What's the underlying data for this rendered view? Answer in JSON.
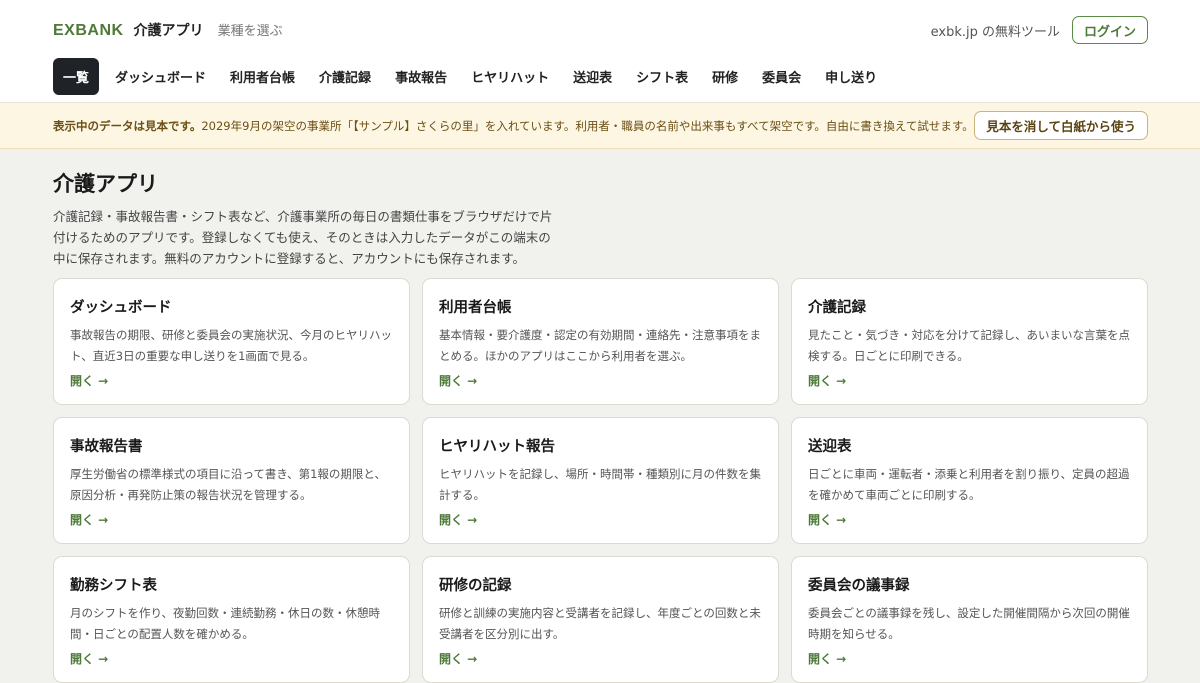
{
  "header": {
    "logo": "EXBANK",
    "app_name": "介護アプリ",
    "choose_business": "業種を選ぶ",
    "free_tools": "exbk.jp の無料ツール",
    "login": "ログイン"
  },
  "nav": {
    "items": [
      {
        "label": "一覧",
        "active": true
      },
      {
        "label": "ダッシュボード"
      },
      {
        "label": "利用者台帳"
      },
      {
        "label": "介護記録"
      },
      {
        "label": "事故報告"
      },
      {
        "label": "ヒヤリハット"
      },
      {
        "label": "送迎表"
      },
      {
        "label": "シフト表"
      },
      {
        "label": "研修"
      },
      {
        "label": "委員会"
      },
      {
        "label": "申し送り"
      }
    ]
  },
  "notice": {
    "bold": "表示中のデータは見本です。",
    "text": "2029年9月の架空の事業所「【サンプル】さくらの里」を入れています。利用者・職員の名前や出来事もすべて架空です。自由に書き換えて試せます。",
    "button": "見本を消して白紙から使う"
  },
  "main": {
    "title": "介護アプリ",
    "description": "介護記録・事故報告書・シフト表など、介護事業所の毎日の書類仕事をブラウザだけで片付けるためのアプリです。登録しなくても使え、そのときは入力したデータがこの端末の中に保存されます。無料のアカウントに登録すると、アカウントにも保存されます。",
    "cards": [
      {
        "title": "ダッシュボード",
        "desc": "事故報告の期限、研修と委員会の実施状況、今月のヒヤリハット、直近3日の重要な申し送りを1画面で見る。",
        "open": "開く →"
      },
      {
        "title": "利用者台帳",
        "desc": "基本情報・要介護度・認定の有効期間・連絡先・注意事項をまとめる。ほかのアプリはここから利用者を選ぶ。",
        "open": "開く →"
      },
      {
        "title": "介護記録",
        "desc": "見たこと・気づき・対応を分けて記録し、あいまいな言葉を点検する。日ごとに印刷できる。",
        "open": "開く →"
      },
      {
        "title": "事故報告書",
        "desc": "厚生労働省の標準様式の項目に沿って書き、第1報の期限と、原因分析・再発防止策の報告状況を管理する。",
        "open": "開く →"
      },
      {
        "title": "ヒヤリハット報告",
        "desc": "ヒヤリハットを記録し、場所・時間帯・種類別に月の件数を集計する。",
        "open": "開く →"
      },
      {
        "title": "送迎表",
        "desc": "日ごとに車両・運転者・添乗と利用者を割り振り、定員の超過を確かめて車両ごとに印刷する。",
        "open": "開く →"
      },
      {
        "title": "勤務シフト表",
        "desc": "月のシフトを作り、夜勤回数・連続勤務・休日の数・休憩時間・日ごとの配置人数を確かめる。",
        "open": "開く →"
      },
      {
        "title": "研修の記録",
        "desc": "研修と訓練の実施内容と受講者を記録し、年度ごとの回数と未受講者を区分別に出す。",
        "open": "開く →"
      },
      {
        "title": "委員会の議事録",
        "desc": "委員会ごとの議事録を残し、設定した開催間隔から次回の開催時期を知らせる。",
        "open": "開く →"
      }
    ]
  }
}
